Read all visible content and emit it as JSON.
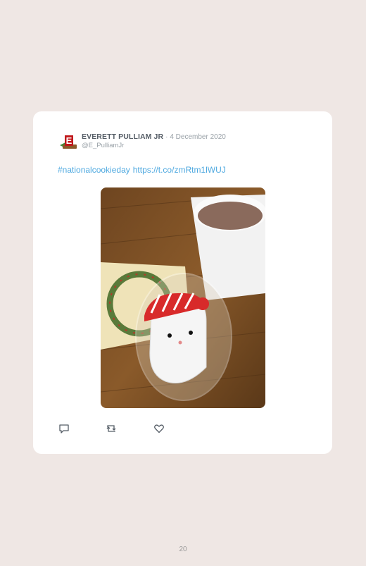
{
  "tweet": {
    "author": "EVERETT PULLIAM JR",
    "separator": "·",
    "date": "4 December 2020",
    "handle": "@E_PulliamJr",
    "hashtag": "#nationalcookieday",
    "link": "https://t.co/zmRtm1lWUJ",
    "photo_icon": "tweet-photo",
    "colors": {
      "link": "#4fa9e0",
      "author": "#555d66",
      "muted": "#9aa2a8"
    }
  },
  "actions": {
    "reply_icon": "reply-icon",
    "retweet_icon": "retweet-icon",
    "like_icon": "heart-icon"
  },
  "page": {
    "number": "20"
  }
}
